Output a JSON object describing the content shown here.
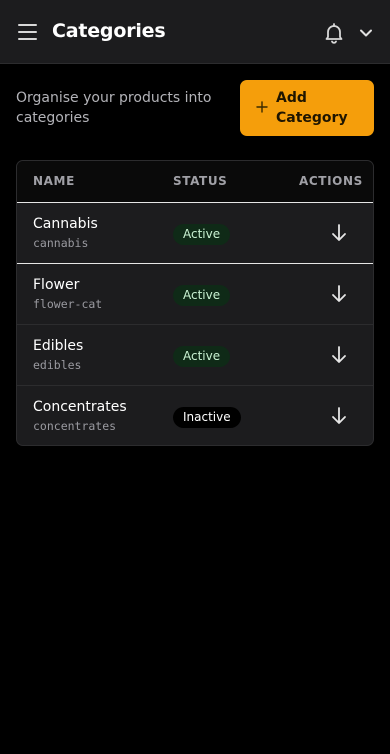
{
  "header": {
    "title": "Categories",
    "menu_icon": "hamburger-menu-icon",
    "notification_icon": "bell-icon",
    "account_icon": "chevron-down-icon"
  },
  "intro_text": "Organise your products into categories",
  "add_button": {
    "icon": "plus-icon",
    "label": "Add Category"
  },
  "table": {
    "columns": [
      "NAME",
      "STATUS",
      "ACTIONS"
    ],
    "rows": [
      {
        "name": "Cannabis",
        "slug": "cannabis",
        "status": "Active",
        "action_icon": "arrow-down-icon"
      },
      {
        "name": "Flower",
        "slug": "flower-cat",
        "status": "Active",
        "action_icon": "arrow-down-icon"
      },
      {
        "name": "Edibles",
        "slug": "edibles",
        "status": "Active",
        "action_icon": "arrow-down-icon"
      },
      {
        "name": "Concentrates",
        "slug": "concentrates",
        "status": "Inactive",
        "action_icon": "arrow-down-icon"
      }
    ]
  },
  "colors": {
    "accent": "#f59e0b",
    "active_badge_bg": "#0f2a17",
    "active_badge_text": "#c9f2d2",
    "inactive_badge_bg": "#000000"
  }
}
